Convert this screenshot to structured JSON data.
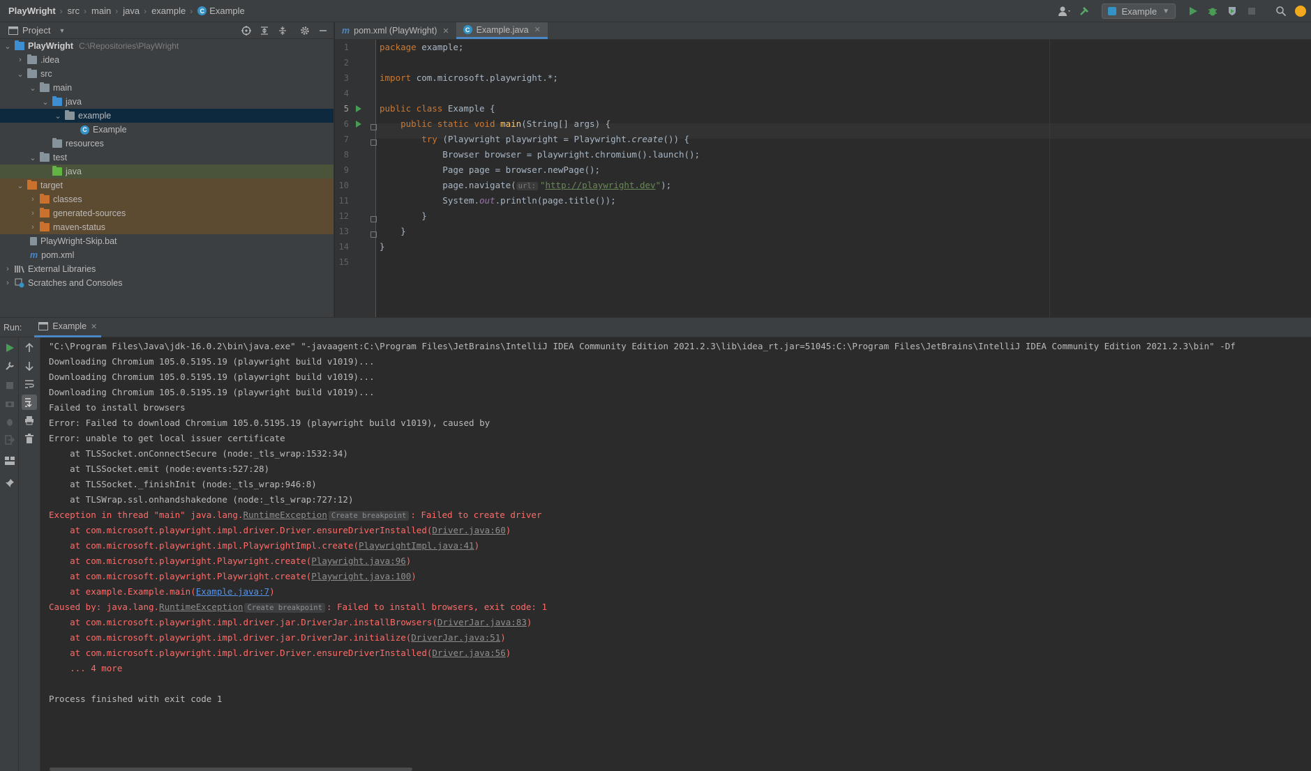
{
  "breadcrumb": {
    "items": [
      "PlayWright",
      "src",
      "main",
      "java",
      "example",
      "Example"
    ]
  },
  "toolbar": {
    "run_config": "Example"
  },
  "project_panel": {
    "title": "Project",
    "tree": [
      {
        "label": "PlayWright",
        "path": "C:\\Repositories\\PlayWright",
        "level": 0,
        "expanded": true,
        "icon": "module-folder"
      },
      {
        "label": ".idea",
        "level": 1,
        "expanded": false,
        "icon": "folder"
      },
      {
        "label": "src",
        "level": 1,
        "expanded": true,
        "icon": "folder"
      },
      {
        "label": "main",
        "level": 2,
        "expanded": true,
        "icon": "folder"
      },
      {
        "label": "java",
        "level": 3,
        "expanded": true,
        "icon": "source-folder"
      },
      {
        "label": "example",
        "level": 4,
        "expanded": true,
        "icon": "package"
      },
      {
        "label": "Example",
        "level": 5,
        "icon": "java-class"
      },
      {
        "label": "resources",
        "level": 3,
        "icon": "resources-folder"
      },
      {
        "label": "test",
        "level": 2,
        "expanded": true,
        "icon": "folder"
      },
      {
        "label": "java",
        "level": 3,
        "icon": "test-folder"
      },
      {
        "label": "target",
        "level": 1,
        "expanded": true,
        "icon": "excluded-folder"
      },
      {
        "label": "classes",
        "level": 2,
        "expanded": false,
        "icon": "excluded-folder"
      },
      {
        "label": "generated-sources",
        "level": 2,
        "expanded": false,
        "icon": "excluded-folder"
      },
      {
        "label": "maven-status",
        "level": 2,
        "expanded": false,
        "icon": "excluded-folder"
      },
      {
        "label": "PlayWright-Skip.bat",
        "level": 1,
        "icon": "bat-file"
      },
      {
        "label": "pom.xml",
        "level": 1,
        "icon": "maven-file"
      },
      {
        "label": "External Libraries",
        "level": 0,
        "expanded": false,
        "icon": "libraries"
      },
      {
        "label": "Scratches and Consoles",
        "level": 0,
        "expanded": false,
        "icon": "scratches"
      }
    ]
  },
  "editor": {
    "tabs": [
      {
        "label": "pom.xml (PlayWright)",
        "active": false
      },
      {
        "label": "Example.java",
        "active": true
      }
    ],
    "line_numbers": [
      "1",
      "2",
      "3",
      "4",
      "5",
      "6",
      "7",
      "8",
      "9",
      "10",
      "11",
      "12",
      "13",
      "14",
      "15"
    ],
    "current_line": 5,
    "code": {
      "l1_kw": "package ",
      "l1_rest": "example;",
      "l3_kw": "import ",
      "l3_rest": "com.microsoft.playwright.*;",
      "l5_kw": "public class ",
      "l5_rest": "Example {",
      "l6_indent": "    ",
      "l6_kw": "public static void ",
      "l6_fn": "main",
      "l6_rest": "(String[] args) {",
      "l7_indent": "        ",
      "l7_kw": "try ",
      "l7_a": "(Playwright playwright = Playwright.",
      "l7_it": "create",
      "l7_b": "()) {",
      "l8": "            Browser browser = playwright.chromium().launch();",
      "l9": "            Page page = browser.newPage();",
      "l10_a": "            page.navigate(",
      "l10_hint": "url:",
      "l10_q1": "\"",
      "l10_url": "http://playwright.dev",
      "l10_q2": "\"",
      "l10_b": ");",
      "l11_a": "            System.",
      "l11_it": "out",
      "l11_b": ".println(page.title());",
      "l12": "        }",
      "l13": "    }",
      "l14": "}"
    }
  },
  "run_panel": {
    "label": "Run:",
    "tab": "Example",
    "output": {
      "cmd": "\"C:\\Program Files\\Java\\jdk-16.0.2\\bin\\java.exe\" \"-javaagent:C:\\Program Files\\JetBrains\\IntelliJ IDEA Community Edition 2021.2.3\\lib\\idea_rt.jar=51045:C:\\Program Files\\JetBrains\\IntelliJ IDEA Community Edition 2021.2.3\\bin\" -Df",
      "dl1": "Downloading Chromium 105.0.5195.19 (playwright build v1019)...",
      "dl2": "Downloading Chromium 105.0.5195.19 (playwright build v1019)...",
      "dl3": "Downloading Chromium 105.0.5195.19 (playwright build v1019)...",
      "fail": "Failed to install browsers",
      "err1": "Error: Failed to download Chromium 105.0.5195.19 (playwright build v1019), caused by",
      "err2": "Error: unable to get local issuer certificate",
      "at1": "    at TLSSocket.onConnectSecure (node:_tls_wrap:1532:34)",
      "at2": "    at TLSSocket.emit (node:events:527:28)",
      "at3": "    at TLSSocket._finishInit (node:_tls_wrap:946:8)",
      "at4": "    at TLSWrap.ssl.onhandshakedone (node:_tls_wrap:727:12)",
      "exc_a": "Exception in thread \"main\" java.lang.",
      "exc_link": "RuntimeException",
      "create_bp": "Create breakpoint",
      "exc_b": ": Failed to create driver",
      "s1_a": "    at com.microsoft.playwright.impl.driver.Driver.ensureDriverInstalled(",
      "s1_link": "Driver.java:60",
      "s1_b": ")",
      "s2_a": "    at com.microsoft.playwright.impl.PlaywrightImpl.create(",
      "s2_link": "PlaywrightImpl.java:41",
      "s2_b": ")",
      "s3_a": "    at com.microsoft.playwright.Playwright.create(",
      "s3_link": "Playwright.java:96",
      "s3_b": ")",
      "s4_a": "    at com.microsoft.playwright.Playwright.create(",
      "s4_link": "Playwright.java:100",
      "s4_b": ")",
      "s5_a": "    at example.Example.main(",
      "s5_link": "Example.java:7",
      "s5_b": ")",
      "cause_a": "Caused by: java.lang.",
      "cause_b": ": Failed to install browsers, exit code: 1",
      "c1_a": "    at com.microsoft.playwright.impl.driver.jar.DriverJar.installBrowsers(",
      "c1_link": "DriverJar.java:83",
      "c1_b": ")",
      "c2_a": "    at com.microsoft.playwright.impl.driver.jar.DriverJar.initialize(",
      "c2_link": "DriverJar.java:51",
      "c2_b": ")",
      "c3_a": "    at com.microsoft.playwright.impl.driver.Driver.ensureDriverInstalled(",
      "c3_link": "Driver.java:56",
      "c3_b": ")",
      "more": "    ... 4 more",
      "exit": "Process finished with exit code 1"
    }
  },
  "colors": {
    "accent": "#4a88c7",
    "error_text": "#ff6b68",
    "keyword": "#cc7832",
    "string": "#6a8759"
  }
}
